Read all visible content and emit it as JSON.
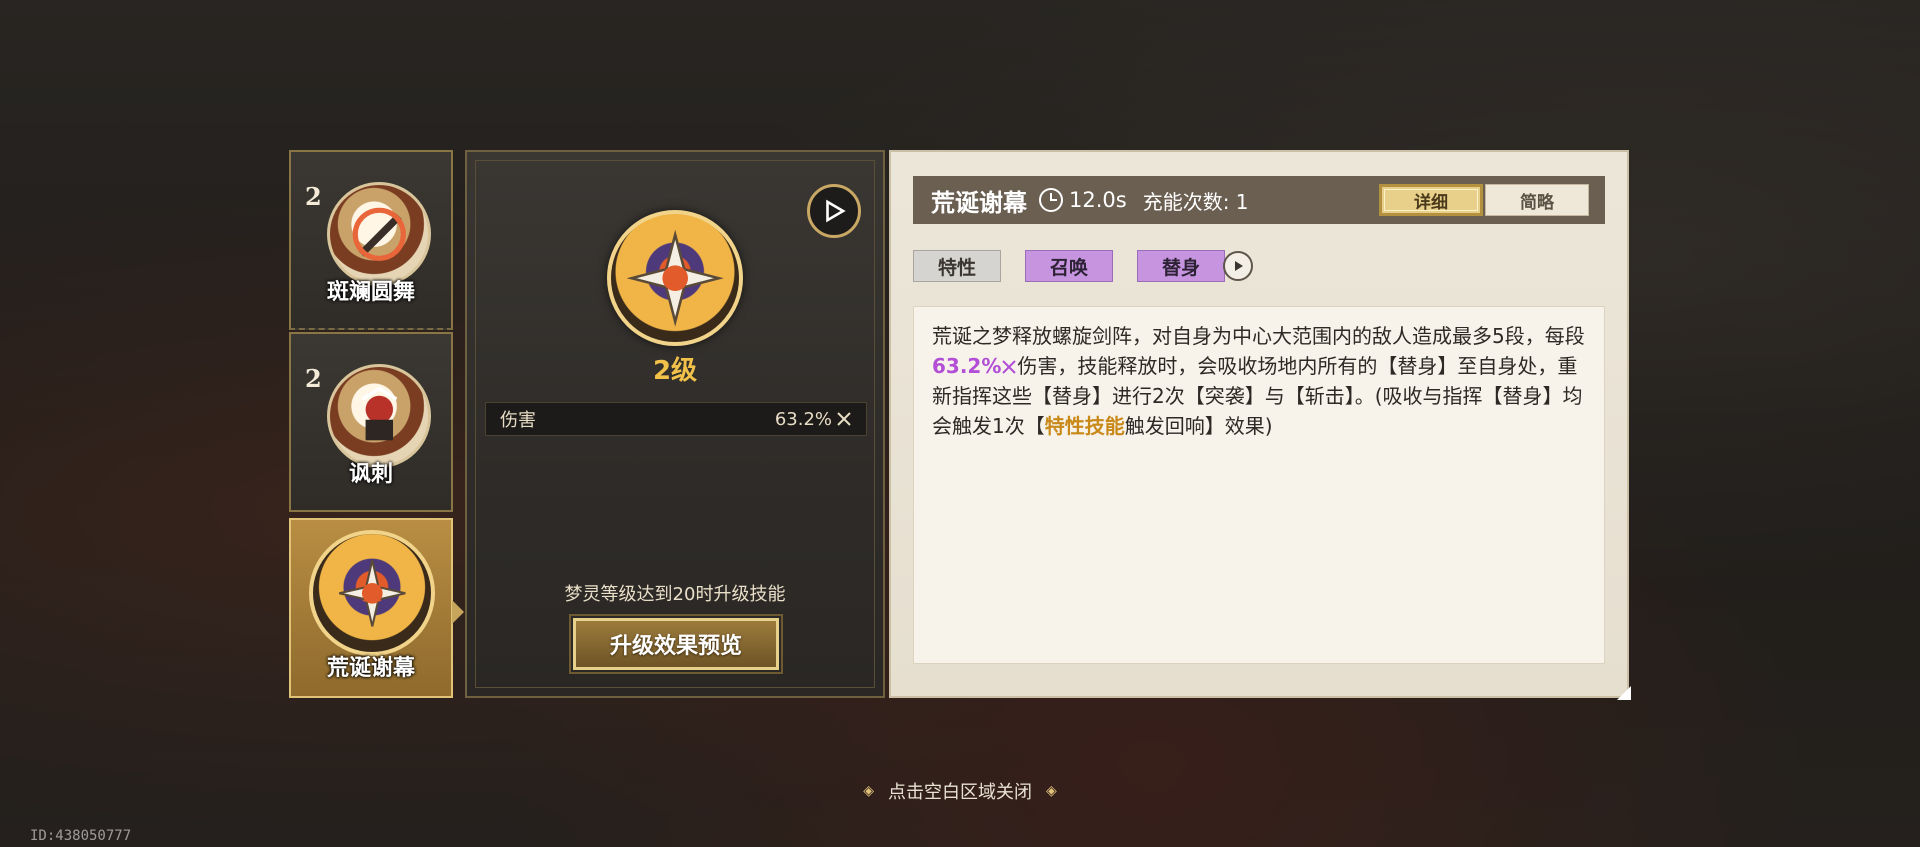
{
  "skill_tabs": [
    {
      "level": "2",
      "name": "斑斓圆舞",
      "icon": "drill-icon"
    },
    {
      "level": "2",
      "name": "讽刺",
      "icon": "jester-icon"
    },
    {
      "level": "",
      "name": "荒诞谢幕",
      "icon": "spinning-blades-icon",
      "selected": true
    }
  ],
  "skill_detail": {
    "level_label": "2级",
    "stat_label": "伤害",
    "stat_value": "63.2%",
    "upgrade_note": "梦灵等级达到20时升级技能",
    "preview_button": "升级效果预览"
  },
  "info_panel": {
    "title": "荒诞谢幕",
    "cooldown": "12.0s",
    "charges": "充能次数: 1",
    "toggle_detail": "详细",
    "toggle_brief": "简略",
    "tags": [
      "特性",
      "召唤",
      "替身"
    ],
    "description_parts": {
      "p1": "荒诞之梦释放螺旋剑阵，对自身为中心大范围内的敌人造成最多5段，每段",
      "pct": "63.2%",
      "p2": "伤害，技能释放时，会吸收场地内所有的【替身】至自身处，重新指挥这些【替身】进行2次【突袭】与【斩击】。(吸收与指挥【替身】均会触发1次【",
      "highlight": "特性技能",
      "p3": "触发回响】效果)"
    }
  },
  "close_hint": "点击空白区域关闭",
  "uid": "ID:438050777",
  "colors": {
    "gold": "#f2c14a",
    "purple_tag": "#c795e0",
    "percent": "#b24fd6",
    "highlight": "#c98919"
  }
}
